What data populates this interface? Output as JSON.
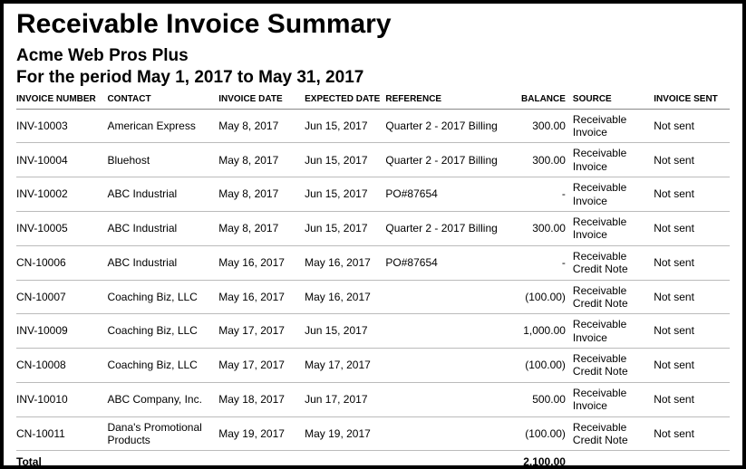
{
  "title": "Receivable Invoice Summary",
  "company": "Acme Web Pros Plus",
  "period": "For the period May 1, 2017 to May 31, 2017",
  "columns": {
    "invoice_number": "INVOICE NUMBER",
    "contact": "CONTACT",
    "invoice_date": "INVOICE DATE",
    "expected_date": "EXPECTED DATE",
    "reference": "REFERENCE",
    "balance": "BALANCE",
    "source": "SOURCE",
    "invoice_sent": "INVOICE SENT"
  },
  "rows": [
    {
      "invoice_number": "INV-10003",
      "contact": "American Express",
      "invoice_date": "May 8, 2017",
      "expected_date": "Jun 15, 2017",
      "reference": "Quarter 2 - 2017 Billing",
      "balance": "300.00",
      "source": "Receivable Invoice",
      "invoice_sent": "Not sent"
    },
    {
      "invoice_number": "INV-10004",
      "contact": "Bluehost",
      "invoice_date": "May 8, 2017",
      "expected_date": "Jun 15, 2017",
      "reference": "Quarter 2 - 2017 Billing",
      "balance": "300.00",
      "source": "Receivable Invoice",
      "invoice_sent": "Not sent"
    },
    {
      "invoice_number": "INV-10002",
      "contact": "ABC Industrial",
      "invoice_date": "May 8, 2017",
      "expected_date": "Jun 15, 2017",
      "reference": "PO#87654",
      "balance": "-",
      "source": "Receivable Invoice",
      "invoice_sent": "Not sent"
    },
    {
      "invoice_number": "INV-10005",
      "contact": "ABC Industrial",
      "invoice_date": "May 8, 2017",
      "expected_date": "Jun 15, 2017",
      "reference": "Quarter 2 - 2017 Billing",
      "balance": "300.00",
      "source": "Receivable Invoice",
      "invoice_sent": "Not sent"
    },
    {
      "invoice_number": "CN-10006",
      "contact": "ABC Industrial",
      "invoice_date": "May 16, 2017",
      "expected_date": "May 16, 2017",
      "reference": "PO#87654",
      "balance": "-",
      "source": "Receivable Credit Note",
      "invoice_sent": "Not sent"
    },
    {
      "invoice_number": "CN-10007",
      "contact": "Coaching Biz, LLC",
      "invoice_date": "May 16, 2017",
      "expected_date": "May 16, 2017",
      "reference": "",
      "balance": "(100.00)",
      "source": "Receivable Credit Note",
      "invoice_sent": "Not sent"
    },
    {
      "invoice_number": "INV-10009",
      "contact": "Coaching Biz, LLC",
      "invoice_date": "May 17, 2017",
      "expected_date": "Jun 15, 2017",
      "reference": "",
      "balance": "1,000.00",
      "source": "Receivable Invoice",
      "invoice_sent": "Not sent"
    },
    {
      "invoice_number": "CN-10008",
      "contact": "Coaching Biz, LLC",
      "invoice_date": "May 17, 2017",
      "expected_date": "May 17, 2017",
      "reference": "",
      "balance": "(100.00)",
      "source": "Receivable Credit Note",
      "invoice_sent": "Not sent"
    },
    {
      "invoice_number": "INV-10010",
      "contact": "ABC Company, Inc.",
      "invoice_date": "May 18, 2017",
      "expected_date": "Jun 17, 2017",
      "reference": "",
      "balance": "500.00",
      "source": "Receivable Invoice",
      "invoice_sent": "Not sent"
    },
    {
      "invoice_number": "CN-10011",
      "contact": "Dana's Promotional Products",
      "invoice_date": "May 19, 2017",
      "expected_date": "May 19, 2017",
      "reference": "",
      "balance": "(100.00)",
      "source": "Receivable Credit Note",
      "invoice_sent": "Not sent"
    }
  ],
  "total": {
    "label": "Total",
    "balance": "2,100.00"
  }
}
